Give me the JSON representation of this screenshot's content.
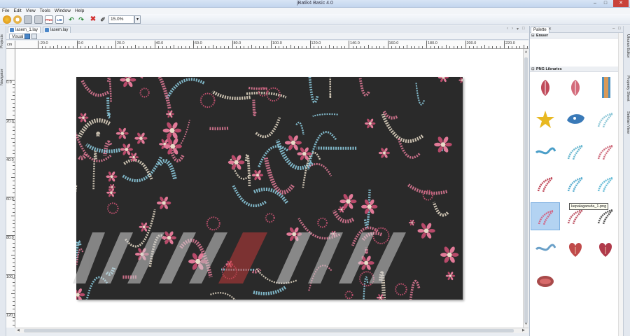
{
  "window": {
    "title": "jBatik4 Basic 4.0",
    "controls": [
      "–",
      "□",
      "✕"
    ]
  },
  "menu": [
    "File",
    "Edit",
    "View",
    "Tools",
    "Window",
    "Help"
  ],
  "toolbar": {
    "zoom_value": "15.0%",
    "dropdown_icon": "chevron-down-icon",
    "png_label": "PNG",
    "lib_label": "LIB"
  },
  "left_panel_tabs": [
    "Projects",
    "Navigator"
  ],
  "document_tabs": [
    {
      "label": "lasem_1.lay",
      "active": true
    },
    {
      "label": "lasem.lay",
      "active": false
    }
  ],
  "view_tab": "Visual",
  "ruler": {
    "unit": "cm",
    "h_labels": [
      "-20.0",
      "0.0",
      "20.0",
      "40.0",
      "60.0",
      "80.0",
      "100.0",
      "120.0",
      "140.0",
      "160.0",
      "180.0",
      "200.0",
      "220.0"
    ],
    "v_labels": [
      "0.0",
      "20.0",
      "40.0",
      "60.0",
      "80.0",
      "100.0",
      "120.0"
    ]
  },
  "palette": {
    "title": "Palette",
    "categories": [
      {
        "name": "Eraser"
      },
      {
        "name": "PNG Libraries"
      }
    ],
    "selected_item_tooltip": "kepalagaruda_1.png"
  },
  "right_panel_tabs": [
    "Ukuran Editor",
    "Property Sheet",
    "Setelan View"
  ],
  "colors": {
    "canvas_bg": "#2a2a2a",
    "motif_pink": "#e27a98",
    "motif_cyan": "#8fd0e4",
    "motif_cream": "#e8dcc8",
    "selection": "#b3d3f2"
  }
}
